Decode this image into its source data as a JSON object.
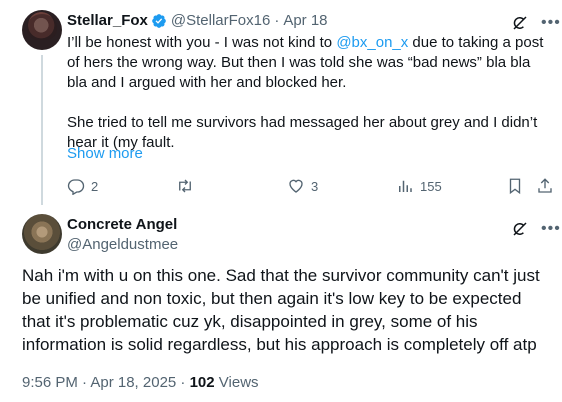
{
  "reply": {
    "author": {
      "display_name": "Stellar_Fox",
      "handle": "@StellarFox16",
      "date": "Apr 18",
      "separator": "·",
      "verified_color": "#1d9bf0"
    },
    "text_para1_a": "I’ll be honest with you - I was not kind to ",
    "mention": "@bx_on_x",
    "text_para1_b": " due to taking a post of hers the wrong way. But then I was told she was “bad news” bla bla bla and I argued with her and blocked her.",
    "text_para2": "She tried to tell me survivors had messaged her about grey and I didn’t hear it (my fault.",
    "show_more": "Show more",
    "actions": {
      "replies": "2",
      "reposts": "",
      "likes": "3",
      "views": "155"
    }
  },
  "main_post": {
    "author": {
      "display_name": "Concrete Angel",
      "handle": "@Angeldustmee"
    },
    "text": "Nah i'm with u on this one. Sad that the survivor community can't just be unified and non toxic, but then again it's low key to be expected that it's problematic cuz yk, disappointed in grey, some of his information is solid regardless, but his approach is completely off atp",
    "time": "9:56 PM · Apr 18, 2025 · ",
    "views_count": "102",
    "views_label": " Views"
  },
  "icons": {
    "more": "more-horizontal-icon",
    "grok": "grok-icon",
    "reply": "reply-icon",
    "repost": "repost-icon",
    "like": "heart-icon",
    "views": "analytics-icon",
    "bookmark": "bookmark-icon",
    "share": "share-icon"
  },
  "colors": {
    "accent": "#1d9bf0",
    "muted": "#536471",
    "text": "#0f1419"
  }
}
